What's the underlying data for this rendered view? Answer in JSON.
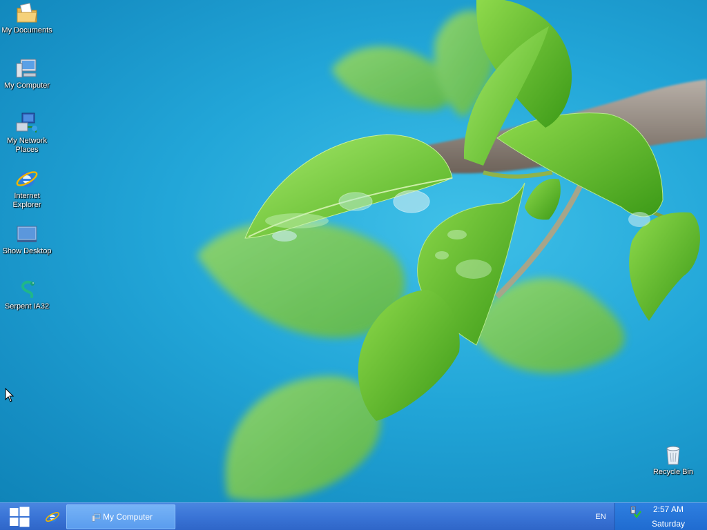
{
  "desktop": {
    "icons": [
      {
        "label": "My Documents",
        "icon": "folder-documents-icon"
      },
      {
        "label": "My Computer",
        "icon": "computer-icon"
      },
      {
        "label": "My Network\nPlaces",
        "icon": "network-places-icon"
      },
      {
        "label": "Internet\nExplorer",
        "icon": "internet-explorer-icon"
      },
      {
        "label": "Show Desktop",
        "icon": "show-desktop-icon"
      },
      {
        "label": "Serpent IA32",
        "icon": "serpent-icon"
      }
    ],
    "recycle_bin": {
      "label": "Recycle Bin",
      "icon": "recycle-bin-icon"
    }
  },
  "taskbar": {
    "start_icon": "windows-logo-icon",
    "quick_launch": [
      {
        "icon": "internet-explorer-icon"
      }
    ],
    "tasks": [
      {
        "label": "My Computer",
        "icon": "computer-icon",
        "active": true
      }
    ],
    "language": "EN",
    "clock": {
      "time": "2:57 AM",
      "day": "Saturday"
    },
    "tray_icons": [
      "network-icon"
    ]
  },
  "colors": {
    "taskbar": "#3a74d6",
    "active_task": "#5a9cee",
    "tray": "#2470d6",
    "wallpaper_sky": "#22a6d8",
    "leaf": "#7bd13a"
  }
}
